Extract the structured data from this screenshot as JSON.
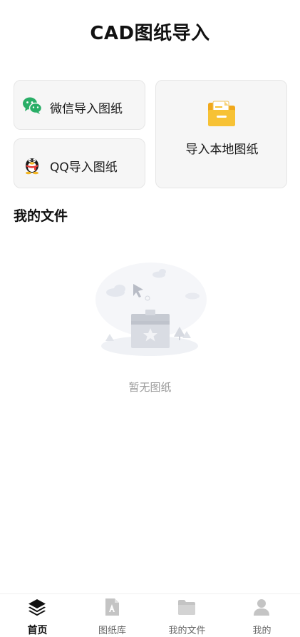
{
  "header": {
    "title": "CAD图纸导入"
  },
  "import_options": {
    "wechat_label": "微信导入图纸",
    "qq_label": "QQ导入图纸",
    "local_label": "导入本地图纸"
  },
  "files": {
    "section_title": "我的文件",
    "empty_text": "暂无图纸"
  },
  "bottom_nav": {
    "items": [
      {
        "label": "首页",
        "icon": "layers-icon",
        "active": true
      },
      {
        "label": "图纸库",
        "icon": "drawing-library-icon",
        "active": false
      },
      {
        "label": "我的文件",
        "icon": "folder-icon",
        "active": false
      },
      {
        "label": "我的",
        "icon": "user-icon",
        "active": false
      }
    ]
  },
  "colors": {
    "wechat_green": "#2aae67",
    "folder_yellow": "#f7c235",
    "card_background": "#f6f6f6",
    "inactive_icon": "#c4c4c4"
  }
}
